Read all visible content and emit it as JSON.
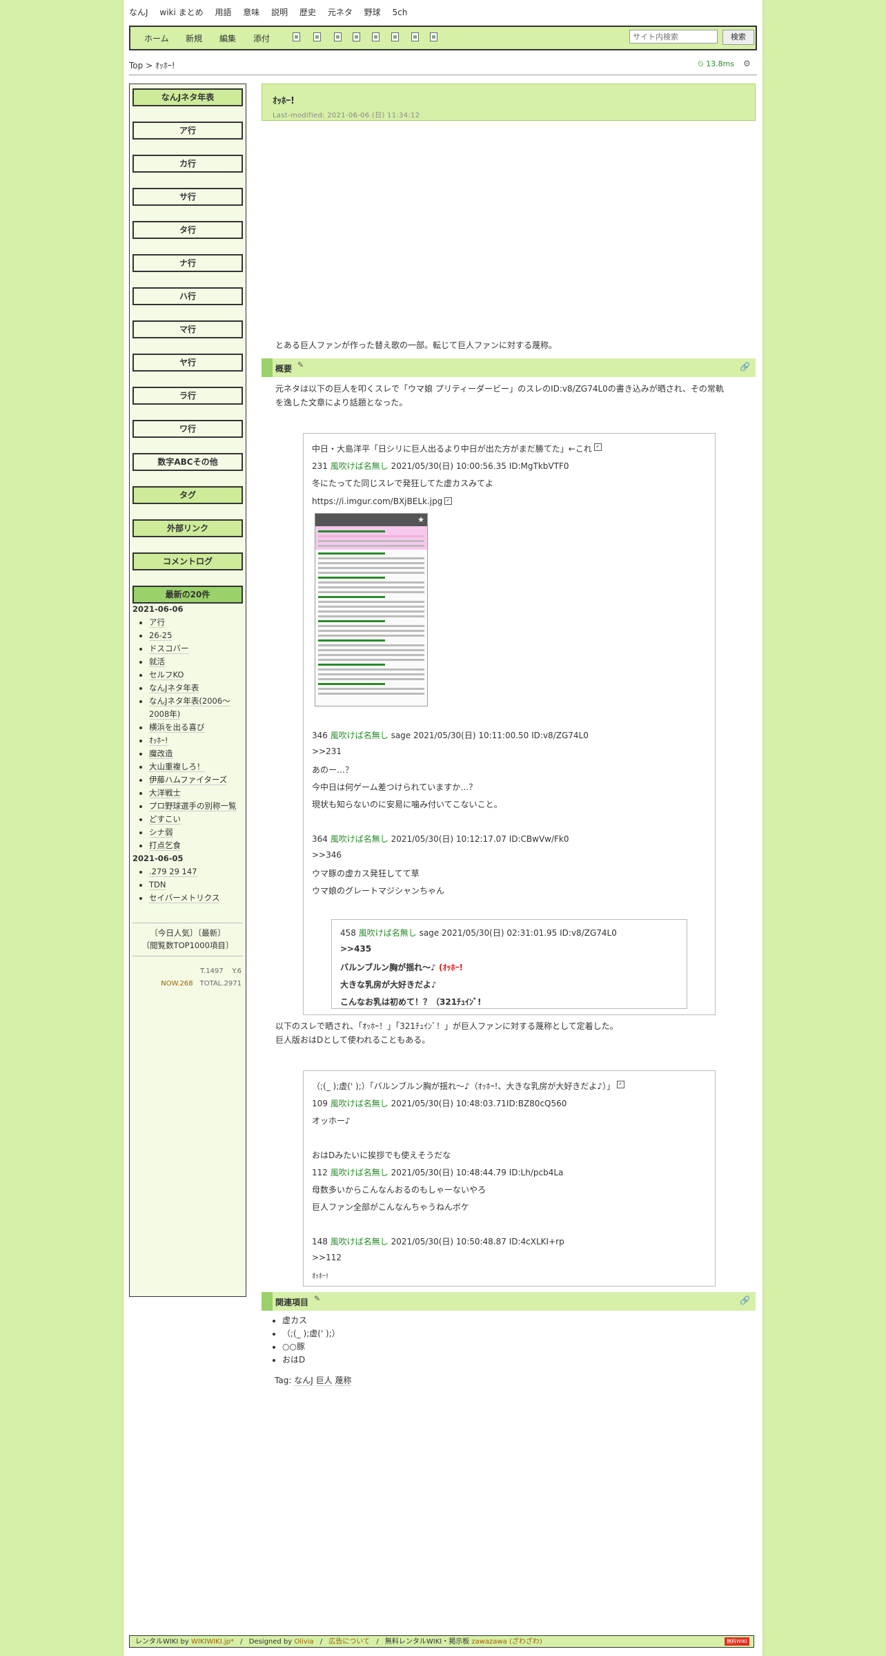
{
  "topnav": [
    "なんJ",
    "wiki まとめ",
    "用語",
    "意味",
    "説明",
    "歴史",
    "元ネタ",
    "野球",
    "5ch"
  ],
  "toolbar": {
    "home": "ホーム",
    "new": "新規",
    "edit": "編集",
    "attach": "添付",
    "icons": [
      "page-icon",
      "copy-icon",
      "delete-icon",
      "save-icon",
      "lock-icon",
      "duplicate-icon",
      "list-icon",
      "backup-icon"
    ],
    "search_placeholder": "サイト内検索",
    "search_button": "検索"
  },
  "breadcrumb": "Top > ｵｯﾎｰ!",
  "timing": "13.8ms",
  "sidebar": {
    "menu": [
      "なんJネタ年表",
      "ア行",
      "カ行",
      "サ行",
      "タ行",
      "ナ行",
      "ハ行",
      "マ行",
      "ヤ行",
      "ラ行",
      "ワ行",
      "数字ABCその他",
      "タグ",
      "外部リンク",
      "コメントログ"
    ],
    "recent_title": "最新の20件",
    "recent_groups": [
      {
        "date": "2021-06-06",
        "items": [
          "ア行",
          "26-25",
          "ドスコバー",
          "就活",
          "セルフKO",
          "なんJネタ年表",
          "なんJネタ年表(2006～2008年)",
          "横浜を出る喜び",
          "ｵｯﾎｰ!",
          "魔改造",
          "大山重複しろ！",
          "伊藤ハムファイターズ",
          "大洋戦士",
          "プロ野球選手の別称一覧",
          "どすこい",
          "シナ弱",
          "打点乞食"
        ]
      },
      {
        "date": "2021-06-05",
        "items": [
          ".279 29 147",
          "TDN",
          "セイバーメトリクス"
        ]
      }
    ],
    "popular_line1": "〔今日人気〕〔最新〕",
    "popular_line2": "〔閲覧数TOP1000項目〕",
    "counter_t": "T.1497",
    "counter_y": "Y.6",
    "counter_now": "NOW.268",
    "counter_total": "TOTAL.2971"
  },
  "page": {
    "title": "ｵｯﾎｰ!",
    "last_modified": "Last-modified: 2021-06-06 (日) 11:34:12",
    "intro": "とある巨人ファンが作った替え歌の一部。転じて巨人ファンに対する蔑称。"
  },
  "section1": {
    "heading": "概要",
    "text1": "元ネタは以下の巨人を叩くスレで「ウマ娘 プリティーダービー」のスレのID:v8/ZG74L0の書き込みが晒され、その常軌",
    "text2": "を逸した文章により話題となった。"
  },
  "quote1": {
    "thread_title": "中日・大島洋平「日シリに巨人出るより中日が出た方がまだ勝てた」←これ",
    "post231_num": "231",
    "post231_name": "風吹けば名無し",
    "post231_meta": "2021/05/30(日) 10:00:56.35 ID:MgTkbVTF0",
    "post231_body": "冬にたってた同じスレで発狂してた虚カスみてよ",
    "post231_link": "https://i.imgur.com/BXjBELk.jpg",
    "post346_num": "346",
    "post346_name": "風吹けば名無し",
    "post346_meta": "sage 2021/05/30(日) 10:11:00.50 ID:v8/ZG74L0",
    "post346_lines": [
      ">>231",
      "あのー…？",
      "今中日は何ゲーム差つけられていますか…？",
      "現状も知らないのに安易に噛み付いてこないこと。"
    ],
    "post364_num": "364",
    "post364_name": "風吹けば名無し",
    "post364_meta": "2021/05/30(日) 10:12:17.07 ID:CBwVw/Fk0",
    "post364_lines": [
      ">>346",
      "ウマ豚の虚カス発狂してて草",
      "ウマ娘のグレートマジシャンちゃん"
    ],
    "post458_num": "458",
    "post458_name": "風吹けば名無し",
    "post458_meta": "sage 2021/05/30(日) 02:31:01.95 ID:v8/ZG74L0",
    "post458_ref": ">>435",
    "post458_line1": "バルンブルン胸が揺れ～♪",
    "post458_shout": "(ｵｯﾎｰ!",
    "post458_line2": "大きな乳房が大好きだよ♪",
    "post458_line3": "こんなお乳は初めて！？（321ﾁｭｲﾝﾞ!"
  },
  "section1b": {
    "text1": "以下のスレで晒され、「ｵｯﾎｰ！」「321ﾁｭｲﾝﾞ！」が巨人ファンに対する蔑称として定着した。",
    "text2": "巨人版おはDとして使われることもある。"
  },
  "quote2": {
    "thread_title": "（;(_ );虚(' );）「バルンブルン胸が揺れ～♪（ｵｯﾎｰ!、大きな乳房が大好きだよ♪）」",
    "post109_num": "109",
    "post109_name": "風吹けば名無し",
    "post109_meta": "2021/05/30(日) 10:48:03.71ID:BZ80cQ560",
    "post109_body": "オッホー♪",
    "post109_body2": "おはDみたいに挨拶でも使えそうだな",
    "post112_num": "112",
    "post112_name": "風吹けば名無し",
    "post112_meta": "2021/05/30(日) 10:48:44.79 ID:Lh/pcb4La",
    "post112_lines": [
      "母数多いからこんなんおるのもしゃーないやろ",
      "巨人ファン全部がこんなんちゃうねんボケ"
    ],
    "post148_num": "148",
    "post148_name": "風吹けば名無し",
    "post148_meta": "2021/05/30(日) 10:50:48.87 ID:4cXLKI+rp",
    "post148_lines": [
      ">>112",
      "ｵｯﾎｰ!"
    ]
  },
  "section2": {
    "heading": "関連項目",
    "items": [
      "虚カス",
      "（;(_ );虚(' );）",
      "○○豚",
      "おはD"
    ]
  },
  "tags": {
    "label": "Tag:",
    "items": [
      "なんJ",
      "巨人",
      "蔑称"
    ]
  },
  "footer": {
    "rental": "レンタルWIKI by",
    "brand": "WIKIWIKI.jp*",
    "designed": "Designed by",
    "designer": "Olivia",
    "ads": "広告について",
    "free": "無料レンタルWIKI・掲示板",
    "zawazawa": "zawazawa (ざわざわ)",
    "badge": "無料WIKI"
  },
  "colors": {
    "background": "#d6f0a8",
    "accent": "#9ad16a",
    "name_green": "#2a8a2a",
    "shout_red": "#e02020"
  }
}
